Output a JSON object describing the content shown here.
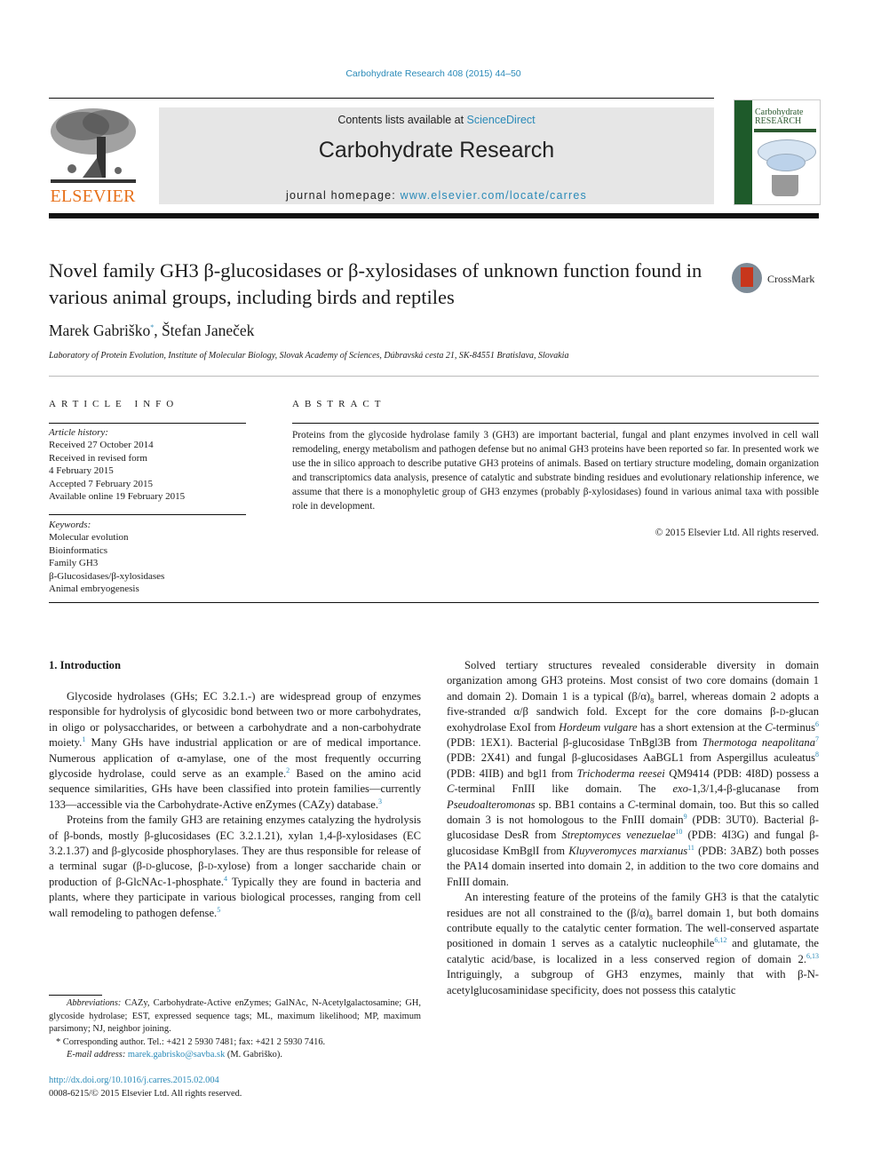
{
  "journal_ref": "Carbohydrate Research 408 (2015) 44–50",
  "header": {
    "publisher_logo_text": "ELSEVIER",
    "contents_prefix": "Contents lists available at ",
    "contents_link": "ScienceDirect",
    "journal_title": "Carbohydrate Research",
    "homepage_prefix": "journal homepage: ",
    "homepage_link": "www.elsevier.com/locate/carres",
    "cover_title_1": "Carbohydrate",
    "cover_title_2": "RESEARCH"
  },
  "crossmark_label": "CrossMark",
  "article": {
    "title": "Novel family GH3 β-glucosidases or β-xylosidases of unknown function found in various animal groups, including birds and reptiles",
    "author_1": "Marek Gabriško",
    "author_1_mark": "*",
    "author_sep": ", ",
    "author_2": "Štefan Janeček",
    "affiliation": "Laboratory of Protein Evolution, Institute of Molecular Biology, Slovak Academy of Sciences, Dúbravská cesta 21, SK-84551 Bratislava, Slovakia"
  },
  "article_info": {
    "heading": "ARTICLE INFO",
    "history_label": "Article history:",
    "history": [
      "Received 27 October 2014",
      "Received in revised form",
      "4 February 2015",
      "Accepted 7 February 2015",
      "Available online 19 February 2015"
    ],
    "keywords_label": "Keywords:",
    "keywords": [
      "Molecular evolution",
      "Bioinformatics",
      "Family GH3",
      "β-Glucosidases/β-xylosidases",
      "Animal embryogenesis"
    ]
  },
  "abstract": {
    "heading": "ABSTRACT",
    "text": "Proteins from the glycoside hydrolase family 3 (GH3) are important bacterial, fungal and plant enzymes involved in cell wall remodeling, energy metabolism and pathogen defense but no animal GH3 proteins have been reported so far. In presented work we use the in silico approach to describe putative GH3 proteins of animals. Based on tertiary structure modeling, domain organization and transcriptomics data analysis, presence of catalytic and substrate binding residues and evolutionary relationship inference, we assume that there is a monophyletic group of GH3 enzymes (probably β-xylosidases) found in various animal taxa with possible role in development.",
    "copyright": "© 2015 Elsevier Ltd. All rights reserved."
  },
  "body": {
    "intro_heading": "1.  Introduction",
    "p1": {
      "a": "Glycoside hydrolases (GHs; EC 3.2.1.-) are widespread group of enzymes responsible for hydrolysis of glycosidic bond between two or more carbohydrates, in oligo or polysaccharides, or between a carbohydrate and a non-carbohydrate moiety.",
      "r1": "1",
      "b": " Many GHs have industrial application or are of medical importance. Numerous application of α-amylase, one of the most frequently occurring glycoside hydrolase, could serve as an example.",
      "r2": "2",
      "c": " Based on the amino acid sequence similarities, GHs have been classified into protein families—currently 133—accessible via the Carbohydrate-Active enZymes (CAZy) database.",
      "r3": "3"
    },
    "p2": {
      "a": "Proteins from the family GH3 are retaining enzymes catalyzing the hydrolysis of β-bonds, mostly β-glucosidases (EC 3.2.1.21), xylan 1,4-β-xylosidases (EC 3.2.1.37) and β-glycoside phosphorylases. They are thus responsible for release of a terminal sugar (β-",
      "d1": "d",
      "b": "-glucose, β-",
      "d2": "d",
      "c": "-xylose) from a longer saccharide chain or production of β-GlcNAc-1-phosphate.",
      "r4": "4",
      "e": " Typically they are found in bacteria and plants, where they participate in various biological processes, ranging from cell wall remodeling to pathogen defense.",
      "r5": "5"
    },
    "p3": {
      "a": "Solved tertiary structures revealed considerable diversity in domain organization among GH3 proteins. Most consist of two core domains (domain 1 and domain 2). Domain 1 is a typical (β/α)",
      "sub8": "8",
      "b": " barrel, whereas domain 2 adopts a five-stranded α/β sandwich fold. Except for the core domains β-",
      "d1": "d",
      "c": "-glucan exohydrolase ExoI from ",
      "sp1": "Hordeum vulgare",
      "e": " has a short extension at the ",
      "ct1": "C",
      "f": "-terminus",
      "r6": "6",
      "g": " (PDB: 1EX1). Bacterial β-glucosidase TnBgl3B from ",
      "sp2": "Thermotoga neapolitana",
      "r7": "7",
      "h": " (PDB: 2X41) and fungal β-glucosidases AaBGL1 from Aspergillus aculeatus",
      "r8": "8",
      "i": " (PDB: 4IIB) and bgl1 from ",
      "sp3": "Trichoderma reesei",
      "j": " QM9414 (PDB: 4I8D) possess a ",
      "ct2": "C",
      "k": "-terminal FnIII like domain. The ",
      "exo": "exo",
      "l": "-1,3/1,4-β-glucanase from ",
      "sp4": "Pseudoalteromonas",
      "m": " sp. BB1 contains a ",
      "ct3": "C",
      "n": "-terminal domain, too. But this so called domain 3 is not homologous to the FnIII domain",
      "r9": "9",
      "o": " (PDB: 3UT0). Bacterial β-glucosidase DesR from ",
      "sp5": "Streptomyces venezuelae",
      "r10": "10",
      "p": " (PDB: 4I3G) and fungal β-glucosidase KmBglI from ",
      "sp6": "Kluyveromyces marxianus",
      "r11": "11",
      "q": " (PDB: 3ABZ) both posses the PA14 domain inserted into domain 2, in addition to the two core domains and FnIII domain."
    },
    "p4": {
      "a": "An interesting feature of the proteins of the family GH3 is that the catalytic residues are not all constrained to the (β/α)",
      "sub8": "8",
      "b": " barrel domain 1, but both domains contribute equally to the catalytic center formation. The well-conserved aspartate positioned in domain 1 serves as a catalytic nucleophile",
      "r612": "6,12",
      "c": " and glutamate, the catalytic acid/base, is localized in a less conserved region of domain 2.",
      "r613": "6,13",
      "d": " Intriguingly, a subgroup of GH3 enzymes, mainly that with β-N-acetylglucosaminidase specificity, does not possess this catalytic"
    }
  },
  "footnotes": {
    "abbrev_label": "Abbreviations:",
    "abbrev_text": " CAZy, Carbohydrate-Active enZymes; GalNAc, N-Acetylgalactosamine; GH, glycoside hydrolase; EST, expressed sequence tags; ML, maximum likelihood; MP, maximum parsimony; NJ, neighbor joining.",
    "corresponding": "* Corresponding author. Tel.: +421 2 5930 7481; fax: +421 2 5930 7416.",
    "email_label": "E-mail address:",
    "email": "marek.gabrisko@savba.sk",
    "email_suffix": " (M. Gabriško).",
    "doi": "http://dx.doi.org/10.1016/j.carres.2015.02.004",
    "issn": "0008-6215/© 2015 Elsevier Ltd. All rights reserved."
  }
}
